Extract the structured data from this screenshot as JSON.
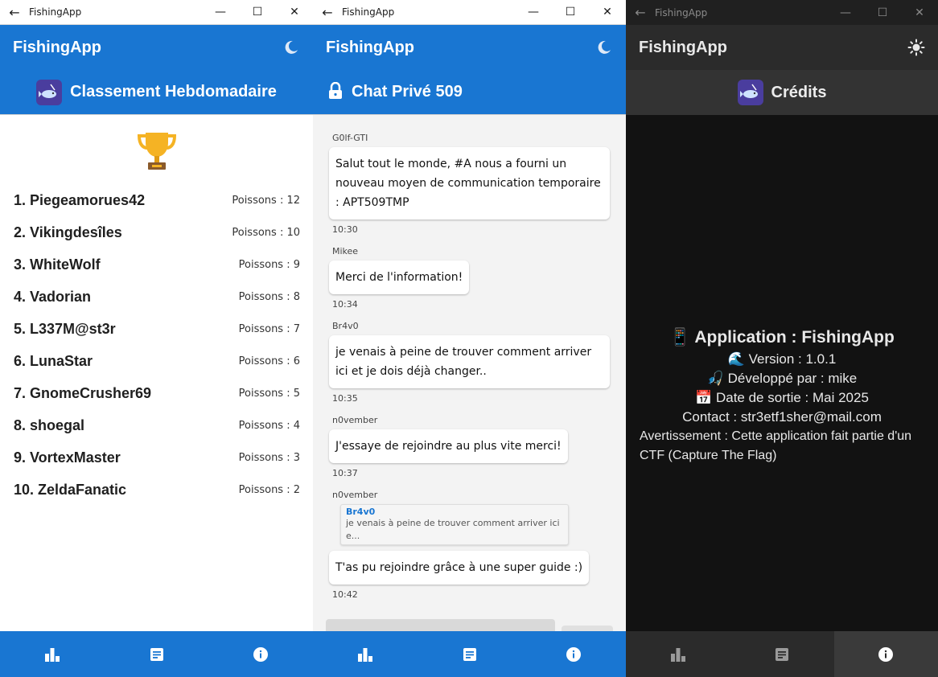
{
  "windows": [
    {
      "window_title": "FishingApp",
      "app_name": "FishingApp",
      "page_title": "Classement Hebdomadaire",
      "leaderboard": [
        {
          "name": "1. Piegeamorues42",
          "score": "Poissons : 12"
        },
        {
          "name": "2. Vikingdesîles",
          "score": "Poissons : 10"
        },
        {
          "name": "3. WhiteWolf",
          "score": "Poissons : 9"
        },
        {
          "name": "4. Vadorian",
          "score": "Poissons : 8"
        },
        {
          "name": "5. L337M@st3r",
          "score": "Poissons : 7"
        },
        {
          "name": "6. LunaStar",
          "score": "Poissons : 6"
        },
        {
          "name": "7. GnomeCrusher69",
          "score": "Poissons : 5"
        },
        {
          "name": "8. shoegal",
          "score": "Poissons : 4"
        },
        {
          "name": "9. VortexMaster",
          "score": "Poissons : 3"
        },
        {
          "name": "10. ZeldaFanatic",
          "score": "Poissons : 2"
        }
      ]
    },
    {
      "window_title": "FishingApp",
      "app_name": "FishingApp",
      "page_title": "Chat Privé 509",
      "messages": [
        {
          "sender": "G0lf-GTI",
          "text": "Salut tout le monde, #A nous a fourni un nouveau moyen de communication temporaire : APT509TMP",
          "time": "10:30"
        },
        {
          "sender": "Mikee",
          "text": "Merci de l'information!",
          "time": "10:34"
        },
        {
          "sender": "Br4v0",
          "text": "je venais à peine de trouver comment arriver ici et je dois déjà changer..",
          "time": "10:35"
        },
        {
          "sender": "n0vember",
          "text": "J'essaye de rejoindre au plus vite merci!",
          "time": "10:37"
        },
        {
          "sender": "n0vember",
          "reply_author": "Br4v0",
          "reply_text": "je venais à peine de trouver comment arriver ici e...",
          "text": "T'as pu rejoindre grâce à une super guide :)",
          "time": "10:42"
        }
      ]
    },
    {
      "window_title": "FishingApp",
      "app_name": "FishingApp",
      "page_title": "Crédits",
      "credits": {
        "title": "📱 Application : FishingApp",
        "version": "🌊 Version : 1.0.1",
        "developer": "🎣 Développé par : mike",
        "release": "📅 Date de sortie : Mai 2025",
        "contact": "Contact : str3etf1sher@mail.com",
        "warning": "Avertissement : Cette application fait partie d'un CTF (Capture The Flag)"
      }
    }
  ],
  "icons": {
    "back": "back-arrow-icon",
    "minimize": "minimize-icon",
    "maximize": "maximize-icon",
    "close": "close-icon",
    "trophy": "trophy-icon",
    "dark_mode": "moon-icon",
    "light_mode": "sun-icon",
    "lock": "lock-icon",
    "nav_leaderboard": "bar-chart-icon",
    "nav_chat": "document-icon",
    "nav_credits": "info-icon"
  },
  "colors": {
    "primary": "#1976d2",
    "dark_bar": "#2b2b2b",
    "dark_bg": "#121212",
    "chat_bg": "#f3f3f3"
  }
}
